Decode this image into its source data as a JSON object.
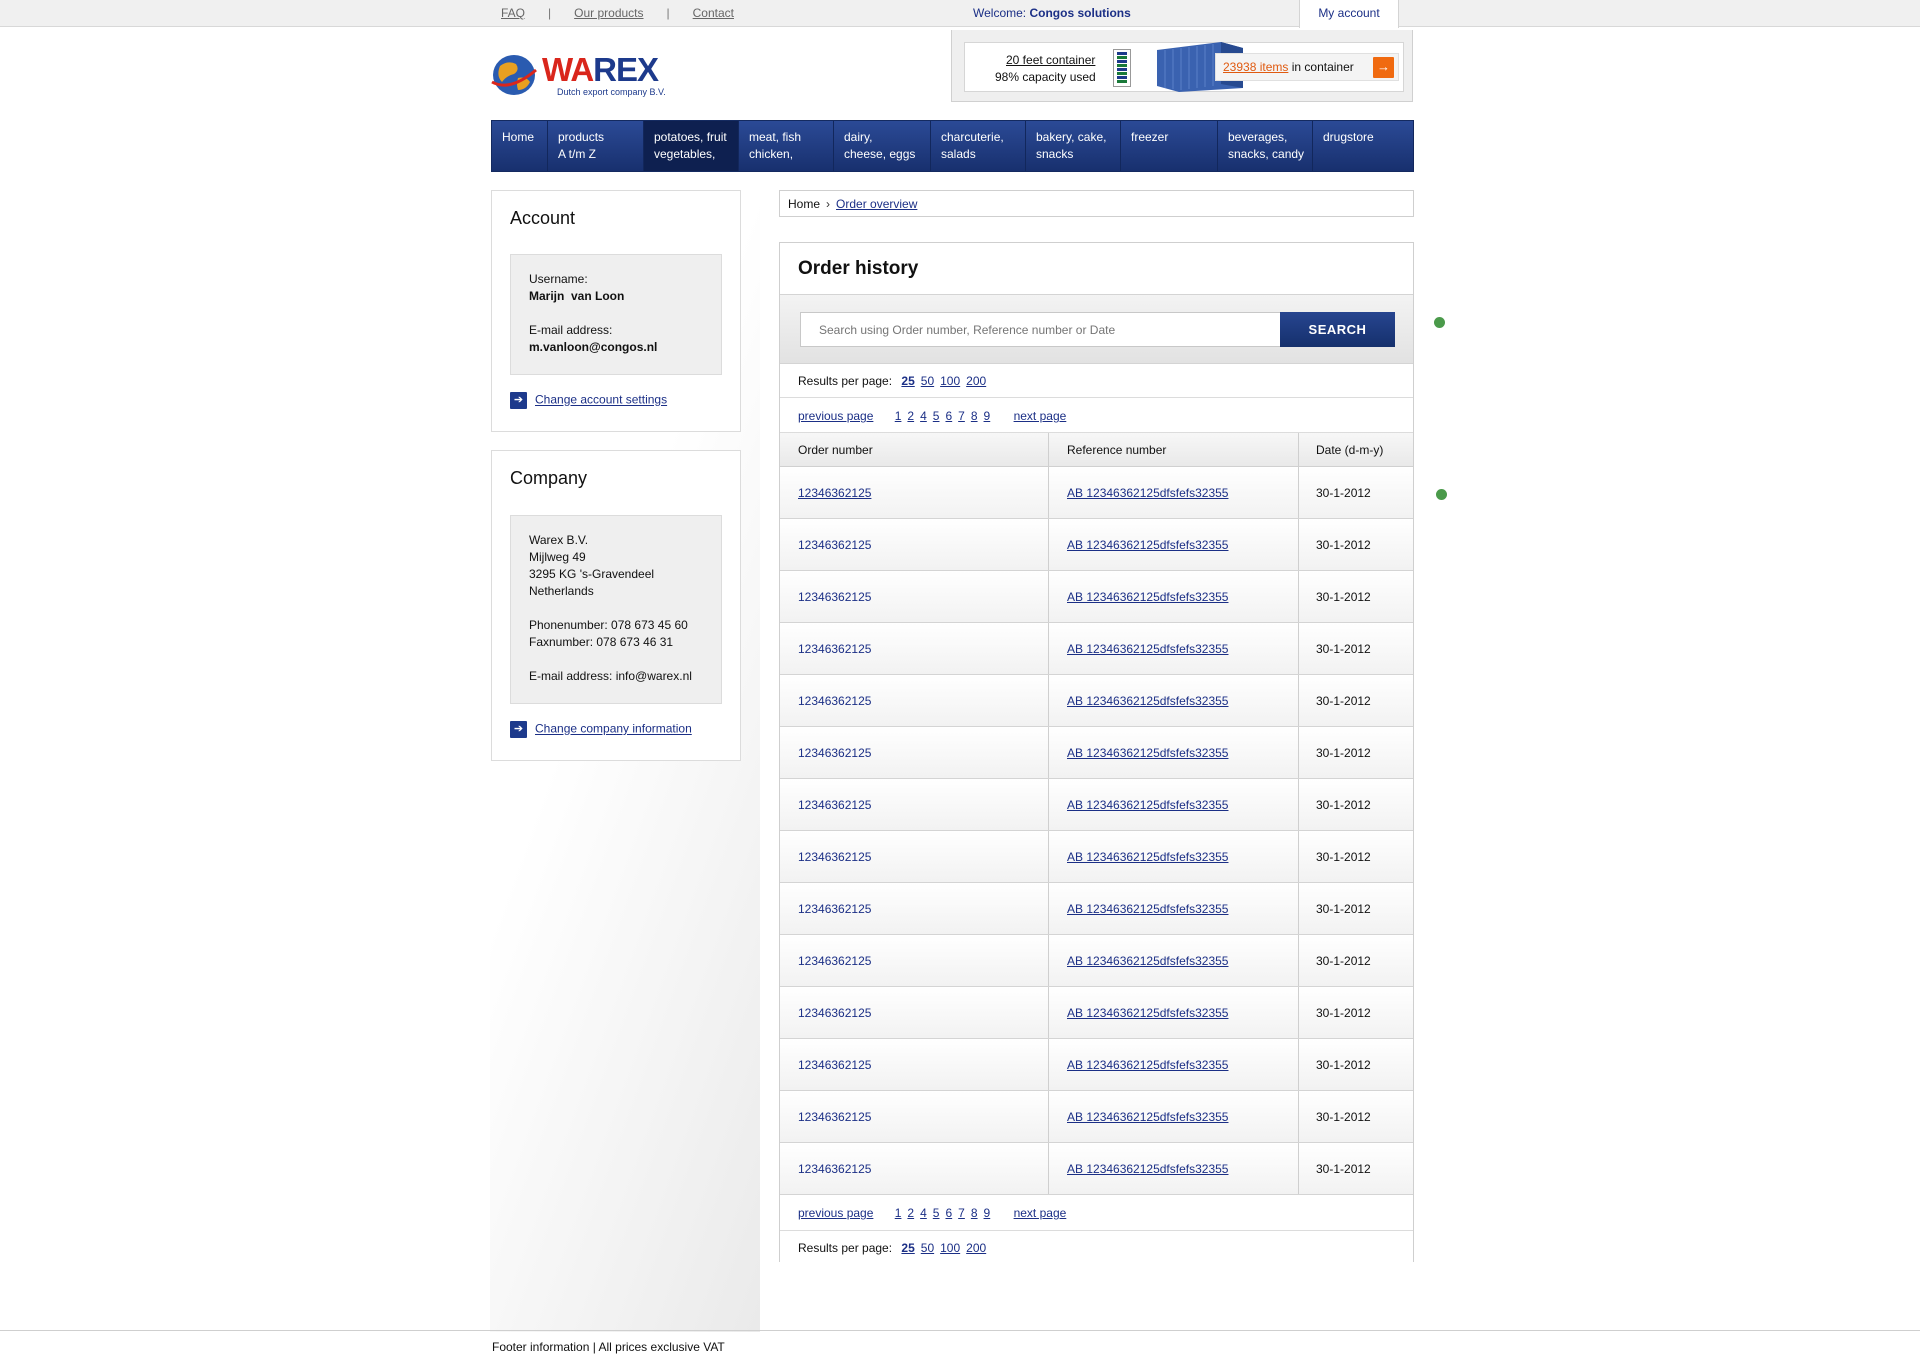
{
  "topbar": {
    "faq": "FAQ",
    "products": "Our products",
    "contact": "Contact",
    "separator": "|",
    "welcome_label": "Welcome:",
    "welcome_name": "Congos solutions",
    "my_account": "My account"
  },
  "logo": {
    "part1": "WA",
    "part2": "REX",
    "subtitle": "Dutch export company B.V."
  },
  "container": {
    "title": "20 feet container",
    "capacity": "98% capacity used",
    "items_count": "23938 items",
    "items_suffix": "in container",
    "go_icon": "arrow-right-icon"
  },
  "nav": [
    {
      "l1": "Home",
      "l2": ""
    },
    {
      "l1": "products",
      "l2": "A t/m Z"
    },
    {
      "l1": "potatoes, fruit",
      "l2": "vegetables,"
    },
    {
      "l1": "meat, fish",
      "l2": "chicken,"
    },
    {
      "l1": "dairy,",
      "l2": "cheese, eggs"
    },
    {
      "l1": "charcuterie,",
      "l2": "salads"
    },
    {
      "l1": "bakery, cake,",
      "l2": "snacks"
    },
    {
      "l1": "freezer",
      "l2": ""
    },
    {
      "l1": "beverages,",
      "l2": "snacks, candy"
    },
    {
      "l1": "drugstore",
      "l2": ""
    }
  ],
  "account": {
    "title": "Account",
    "username_label": "Username:",
    "username": "Marijn  van Loon",
    "email_label": "E-mail address:",
    "email": "m.vanloon@congos.nl",
    "change_link": "Change account settings"
  },
  "company": {
    "title": "Company",
    "name": "Warex B.V.",
    "street": "Mijlweg 49",
    "city": "3295 KG 's-Gravendeel",
    "country": "Netherlands",
    "phone": "Phonenumber: 078 673 45 60",
    "fax": "Faxnumber: 078 673 46 31",
    "email": "E-mail address: info@warex.nl",
    "change_link": "Change company information"
  },
  "breadcrumb": {
    "home": "Home",
    "current": "Order overview"
  },
  "orders": {
    "title": "Order history",
    "search_placeholder": "Search using Order number, Reference number or Date",
    "search_button": "SEARCH",
    "rpp_label": "Results per page:",
    "rpp_options": [
      "25",
      "50",
      "100",
      "200"
    ],
    "prev": "previous page",
    "next": "next page",
    "pages": [
      "1",
      "2",
      "4",
      "5",
      "6",
      "7",
      "8",
      "9"
    ],
    "columns": [
      "Order number",
      "Reference number",
      "Date (d-m-y)"
    ],
    "rows": [
      [
        "12346362125",
        "AB 12346362125dfsfefs32355",
        "30-1-2012"
      ],
      [
        "12346362125",
        "AB 12346362125dfsfefs32355",
        "30-1-2012"
      ],
      [
        "12346362125",
        "AB 12346362125dfsfefs32355",
        "30-1-2012"
      ],
      [
        "12346362125",
        "AB 12346362125dfsfefs32355",
        "30-1-2012"
      ],
      [
        "12346362125",
        "AB 12346362125dfsfefs32355",
        "30-1-2012"
      ],
      [
        "12346362125",
        "AB 12346362125dfsfefs32355",
        "30-1-2012"
      ],
      [
        "12346362125",
        "AB 12346362125dfsfefs32355",
        "30-1-2012"
      ],
      [
        "12346362125",
        "AB 12346362125dfsfefs32355",
        "30-1-2012"
      ],
      [
        "12346362125",
        "AB 12346362125dfsfefs32355",
        "30-1-2012"
      ],
      [
        "12346362125",
        "AB 12346362125dfsfefs32355",
        "30-1-2012"
      ],
      [
        "12346362125",
        "AB 12346362125dfsfefs32355",
        "30-1-2012"
      ],
      [
        "12346362125",
        "AB 12346362125dfsfefs32355",
        "30-1-2012"
      ],
      [
        "12346362125",
        "AB 12346362125dfsfefs32355",
        "30-1-2012"
      ],
      [
        "12346362125",
        "AB 12346362125dfsfefs32355",
        "30-1-2012"
      ]
    ]
  },
  "footer": "Footer information | All prices exclusive VAT",
  "colors": {
    "brand_blue": "#1d3a8c",
    "brand_red": "#d9261c",
    "accent_orange": "#f06a10",
    "status_dot": "#4a9a4a"
  }
}
